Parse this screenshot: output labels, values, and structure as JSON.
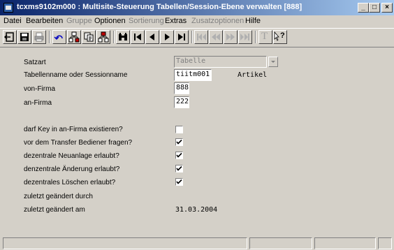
{
  "window": {
    "title": "tcxms9102m000 : Multisite-Steuerung Tabellen/Session-Ebene verwalten [888]",
    "minimize": "_",
    "maximize": "□",
    "close": "×"
  },
  "menu": [
    {
      "label": "Datei",
      "enabled": true
    },
    {
      "label": "Bearbeiten",
      "enabled": true
    },
    {
      "label": "Gruppe",
      "enabled": false
    },
    {
      "label": "Optionen",
      "enabled": true
    },
    {
      "label": "Sortierung",
      "enabled": false
    },
    {
      "label": "Extras",
      "enabled": true
    },
    {
      "label": "Zusatzoptionen",
      "enabled": false
    },
    {
      "label": "Hilfe",
      "enabled": true
    }
  ],
  "toolbar": {
    "text_button": "T",
    "help_button": "?"
  },
  "form": {
    "satzart": {
      "label": "Satzart",
      "value": "Tabelle"
    },
    "tabellenname": {
      "label": "Tabellenname oder Sessionname",
      "value": "tiitm001",
      "description": "Artikel"
    },
    "von_firma": {
      "label": "von-Firma",
      "value": "888"
    },
    "an_firma": {
      "label": "an-Firma",
      "value": "222"
    },
    "key_exist": {
      "label": "darf Key in an-Firma existieren?",
      "checked": false
    },
    "ask_user": {
      "label": "vor dem Transfer Bediener fragen?",
      "checked": true
    },
    "new_allowed": {
      "label": "dezentrale Neuanlage erlaubt?",
      "checked": true
    },
    "change_allowed": {
      "label": "denzentrale Änderung erlaubt?",
      "checked": true
    },
    "delete_allowed": {
      "label": "dezentrales Löschen erlaubt?",
      "checked": true
    },
    "changed_by": {
      "label": "zuletzt geändert durch",
      "value": ""
    },
    "changed_on": {
      "label": "zuletzt geändert am",
      "value": "31.03.2004"
    }
  },
  "colors": {
    "titlebar_start": "#0a246a",
    "titlebar_end": "#a6caf0",
    "window_bg": "#d4d0c8"
  }
}
